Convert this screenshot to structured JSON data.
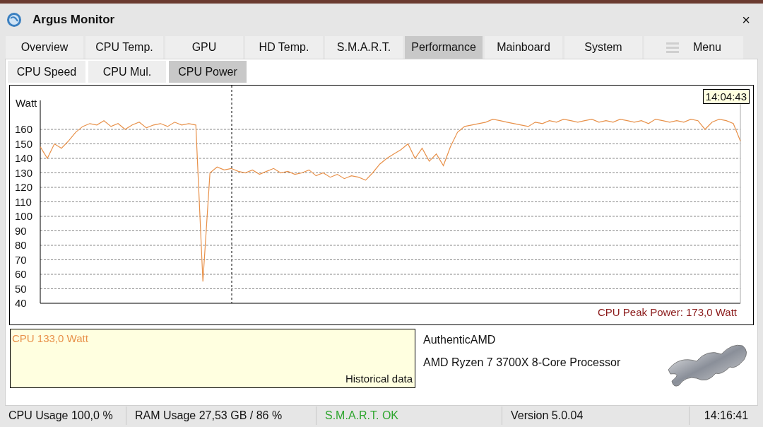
{
  "window": {
    "title": "Argus Monitor",
    "close": "×"
  },
  "tabs": [
    {
      "label": "Overview",
      "selected": false,
      "kind": "tab"
    },
    {
      "label": "CPU Temp.",
      "selected": false,
      "kind": "tab"
    },
    {
      "label": "GPU",
      "selected": false,
      "kind": "tab"
    },
    {
      "label": "HD Temp.",
      "selected": false,
      "kind": "tab"
    },
    {
      "label": "S.M.A.R.T.",
      "selected": false,
      "kind": "tab"
    },
    {
      "label": "Performance",
      "selected": true,
      "kind": "tab"
    },
    {
      "label": "Mainboard",
      "selected": false,
      "kind": "tab"
    },
    {
      "label": "System",
      "selected": false,
      "kind": "tab"
    },
    {
      "label": "Menu",
      "selected": false,
      "kind": "menu"
    }
  ],
  "subtabs": [
    {
      "label": "CPU Speed",
      "selected": false
    },
    {
      "label": "CPU Mul.",
      "selected": false
    },
    {
      "label": "CPU Power",
      "selected": true
    }
  ],
  "graph": {
    "timestamp": "14:04:43",
    "peak": "CPU Peak Power: 173,0 Watt",
    "chart_data": {
      "type": "line",
      "grid": true,
      "ylabel": "Watt",
      "ylim": [
        40,
        180
      ],
      "yticks": [
        40,
        50,
        60,
        70,
        80,
        90,
        100,
        110,
        120,
        130,
        140,
        150,
        160
      ],
      "series": [
        {
          "color": "#e8914a",
          "values": [
            148,
            140,
            150,
            147,
            152,
            158,
            162,
            164,
            163,
            166,
            162,
            164,
            160,
            163,
            165,
            161,
            163,
            164,
            162,
            165,
            163,
            164,
            163,
            55,
            130,
            134,
            132,
            133,
            131,
            130,
            132,
            129,
            131,
            133,
            130,
            131,
            129,
            130,
            132,
            128,
            130,
            127,
            129,
            126,
            128,
            127,
            125,
            130,
            136,
            140,
            143,
            146,
            150,
            140,
            147,
            138,
            143,
            135,
            148,
            158,
            162,
            163,
            164,
            165,
            167,
            166,
            165,
            164,
            163,
            162,
            165,
            164,
            166,
            165,
            167,
            166,
            165,
            166,
            167,
            165,
            166,
            165,
            167,
            166,
            165,
            166,
            164,
            167,
            166,
            165,
            166,
            165,
            167,
            166,
            160,
            165,
            167,
            166,
            164,
            152
          ]
        }
      ]
    }
  },
  "current": {
    "reading": "CPU 133,0 Watt",
    "caption": "Historical data"
  },
  "cpu": {
    "vendor": "AuthenticAMD",
    "model": "AMD Ryzen 7 3700X 8-Core Processor"
  },
  "status_bar": [
    {
      "text": "CPU Usage 100,0 %",
      "kind": "normal"
    },
    {
      "text": "RAM Usage 27,53 GB / 86 %",
      "kind": "normal"
    },
    {
      "text": "S.M.A.R.T. OK",
      "kind": "ok"
    },
    {
      "text": "Version 5.0.04",
      "kind": "normal"
    },
    {
      "text": "14:16:41",
      "kind": "clock"
    }
  ]
}
